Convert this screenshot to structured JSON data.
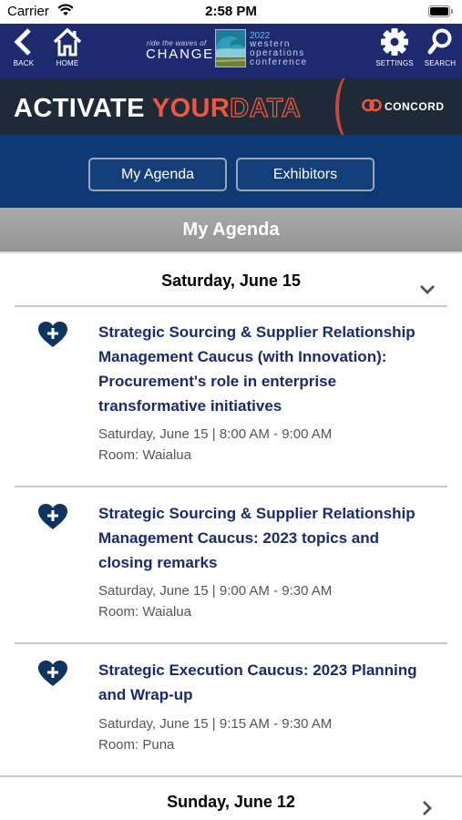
{
  "status_bar": {
    "carrier": "Carrier",
    "time": "2:58 PM"
  },
  "nav": {
    "back_label": "BACK",
    "home_label": "HOME",
    "settings_label": "SETTINGS",
    "search_label": "SEARCH",
    "icons": [
      "chevron-left-icon",
      "home-icon",
      "gear-icon",
      "search-icon"
    ],
    "logo": {
      "tagline": "ride the waves of",
      "change": "CHANGE",
      "year": "2022",
      "name_line1": "western",
      "name_line2": "operations",
      "name_line3": "conference"
    }
  },
  "banner": {
    "word1": "ACTIVATE",
    "word2": "YOUR",
    "word3": "DATA",
    "sponsor": "CONCORD",
    "colors": {
      "background": "#1e2b37",
      "accent": "#f3553e"
    }
  },
  "tabs": {
    "agenda_label": "My Agenda",
    "exhibitors_label": "Exhibitors"
  },
  "page_title": "My Agenda",
  "days": [
    {
      "label": "Saturday, June 15",
      "expanded": true
    },
    {
      "label": "Sunday, June 12",
      "expanded": false
    }
  ],
  "sessions": [
    {
      "title": "Strategic Sourcing & Supplier Relationship Management Caucus (with Innovation): Procurement's role in enterprise transformative initiatives",
      "time": "Saturday, June 15 | 8:00 AM - 9:00 AM",
      "room": "Room: Waialua"
    },
    {
      "title": "Strategic Sourcing & Supplier Relationship Management Caucus: 2023 topics and closing remarks",
      "time": "Saturday, June 15 | 9:00 AM - 9:30 AM",
      "room": "Room: Waialua"
    },
    {
      "title": "Strategic Execution Caucus: 2023 Planning and Wrap-up",
      "time": "Saturday, June 15 | 9:15 AM - 9:30 AM",
      "room": "Room: Puna"
    }
  ],
  "colors": {
    "nav": "#1e2a6e",
    "tabs": "#0d3a72",
    "session_title": "#1b2a6b",
    "favorite_icon": "#0f3460"
  }
}
